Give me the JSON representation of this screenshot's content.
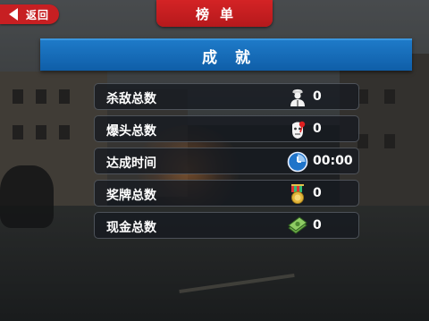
{
  "top_bar": {
    "back_label": "返回",
    "title": "榜单"
  },
  "section": {
    "title": "成就"
  },
  "stats": [
    {
      "label": "杀敌总数",
      "icon": "soldier-icon",
      "value": "0"
    },
    {
      "label": "爆头总数",
      "icon": "headshot-icon",
      "value": "0"
    },
    {
      "label": "达成时间",
      "icon": "clock-icon",
      "value": "00:00"
    },
    {
      "label": "奖牌总数",
      "icon": "medal-icon",
      "value": "0"
    },
    {
      "label": "现金总数",
      "icon": "cash-icon",
      "value": "0"
    }
  ],
  "colors": {
    "accent_red": "#c71f22",
    "header_blue": "#1a6fbd"
  }
}
